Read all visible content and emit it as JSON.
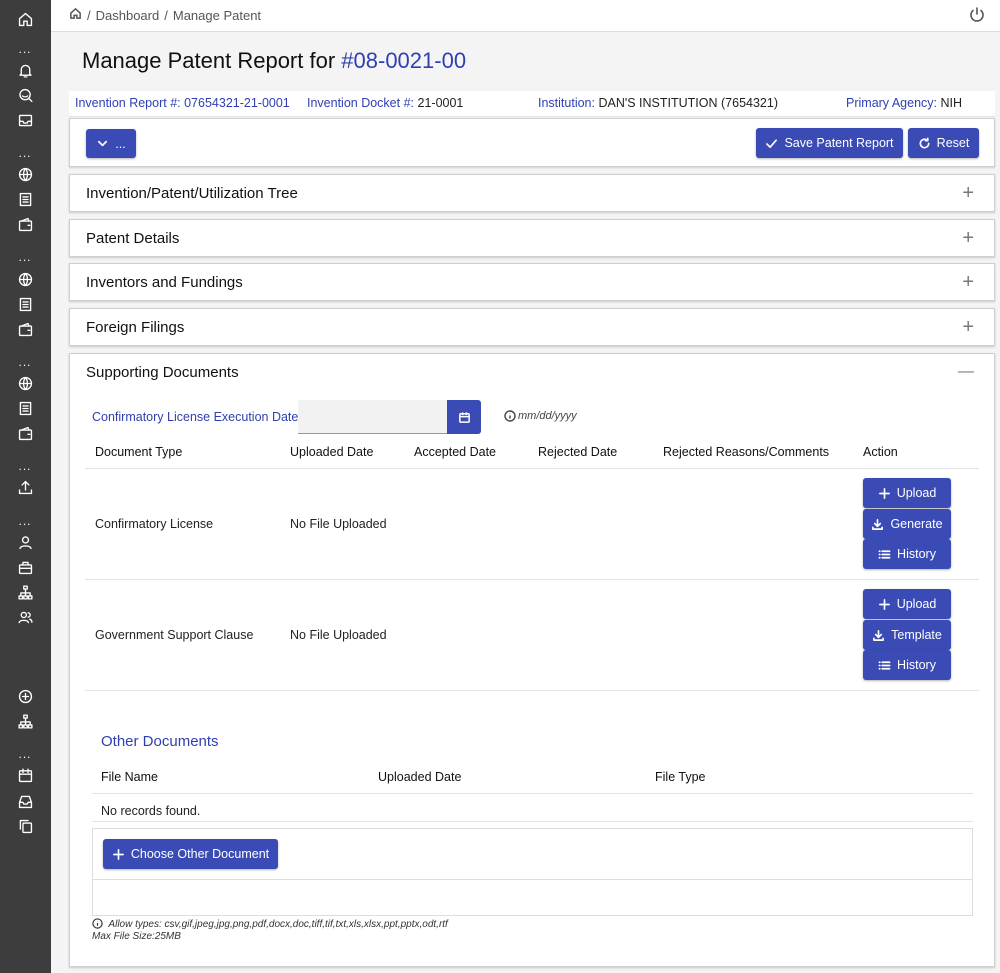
{
  "breadcrumb": {
    "root": "Dashboard",
    "current": "Manage Patent",
    "sep": "/"
  },
  "page": {
    "title_prefix": "Manage Patent Report for",
    "title_number": "#08-0021-00"
  },
  "info": {
    "invention_report_label": "Invention Report #:",
    "invention_report_value": "07654321-21-0001",
    "docket_label": "Invention Docket #:",
    "docket_value": "21-0001",
    "institution_label": "Institution:",
    "institution_value": "DAN'S INSTITUTION (7654321)",
    "agency_label": "Primary Agency:",
    "agency_value": "NIH"
  },
  "toolbar": {
    "menu_label": "...",
    "save_label": "Save Patent Report",
    "reset_label": "Reset"
  },
  "panels": {
    "tree": "Invention/Patent/Utilization Tree",
    "details": "Patent Details",
    "inventors": "Inventors and Fundings",
    "foreign": "Foreign Filings",
    "supporting": "Supporting Documents",
    "expand_symbol": "+",
    "collapse_symbol": "—"
  },
  "supporting": {
    "date_label": "Confirmatory License Execution Date",
    "date_value": "",
    "date_hint": "mm/dd/yyyy",
    "columns": [
      "Document Type",
      "Uploaded Date",
      "Accepted Date",
      "Rejected Date",
      "Rejected Reasons/Comments",
      "Action"
    ],
    "rows": [
      {
        "type": "Confirmatory License",
        "uploaded": "No File Uploaded",
        "accepted": "",
        "rejected": "",
        "comments": "",
        "actions": [
          "Upload",
          "Generate",
          "History"
        ]
      },
      {
        "type": "Government Support Clause",
        "uploaded": "No File Uploaded",
        "accepted": "",
        "rejected": "",
        "comments": "",
        "actions": [
          "Upload",
          "Template",
          "History"
        ]
      }
    ]
  },
  "other_documents": {
    "title": "Other Documents",
    "columns": [
      "File Name",
      "Uploaded Date",
      "File Type"
    ],
    "empty": "No records found.",
    "choose_label": "Choose Other Document",
    "allow_types": "Allow types: csv,gif,jpeg,jpg,png,pdf,docx,doc,tiff,tif,txt,xls,xlsx,ppt,pptx,odt,rtf",
    "max_size": "Max File Size:25MB"
  },
  "colors": {
    "accent": "#3a4bb5",
    "link": "#2f3fb0",
    "sidebar": "#3d3d3d"
  },
  "icons": [
    "home-icon",
    "bell-icon",
    "search-chat-icon",
    "mail-icon",
    "globe-icon",
    "document-icon",
    "wallet-icon",
    "upload-icon",
    "user-icon",
    "briefcase-icon",
    "sitemap-icon",
    "users-icon",
    "plus-circle-icon",
    "calendar-icon",
    "inbox-icon",
    "copy-icon",
    "power-icon"
  ]
}
